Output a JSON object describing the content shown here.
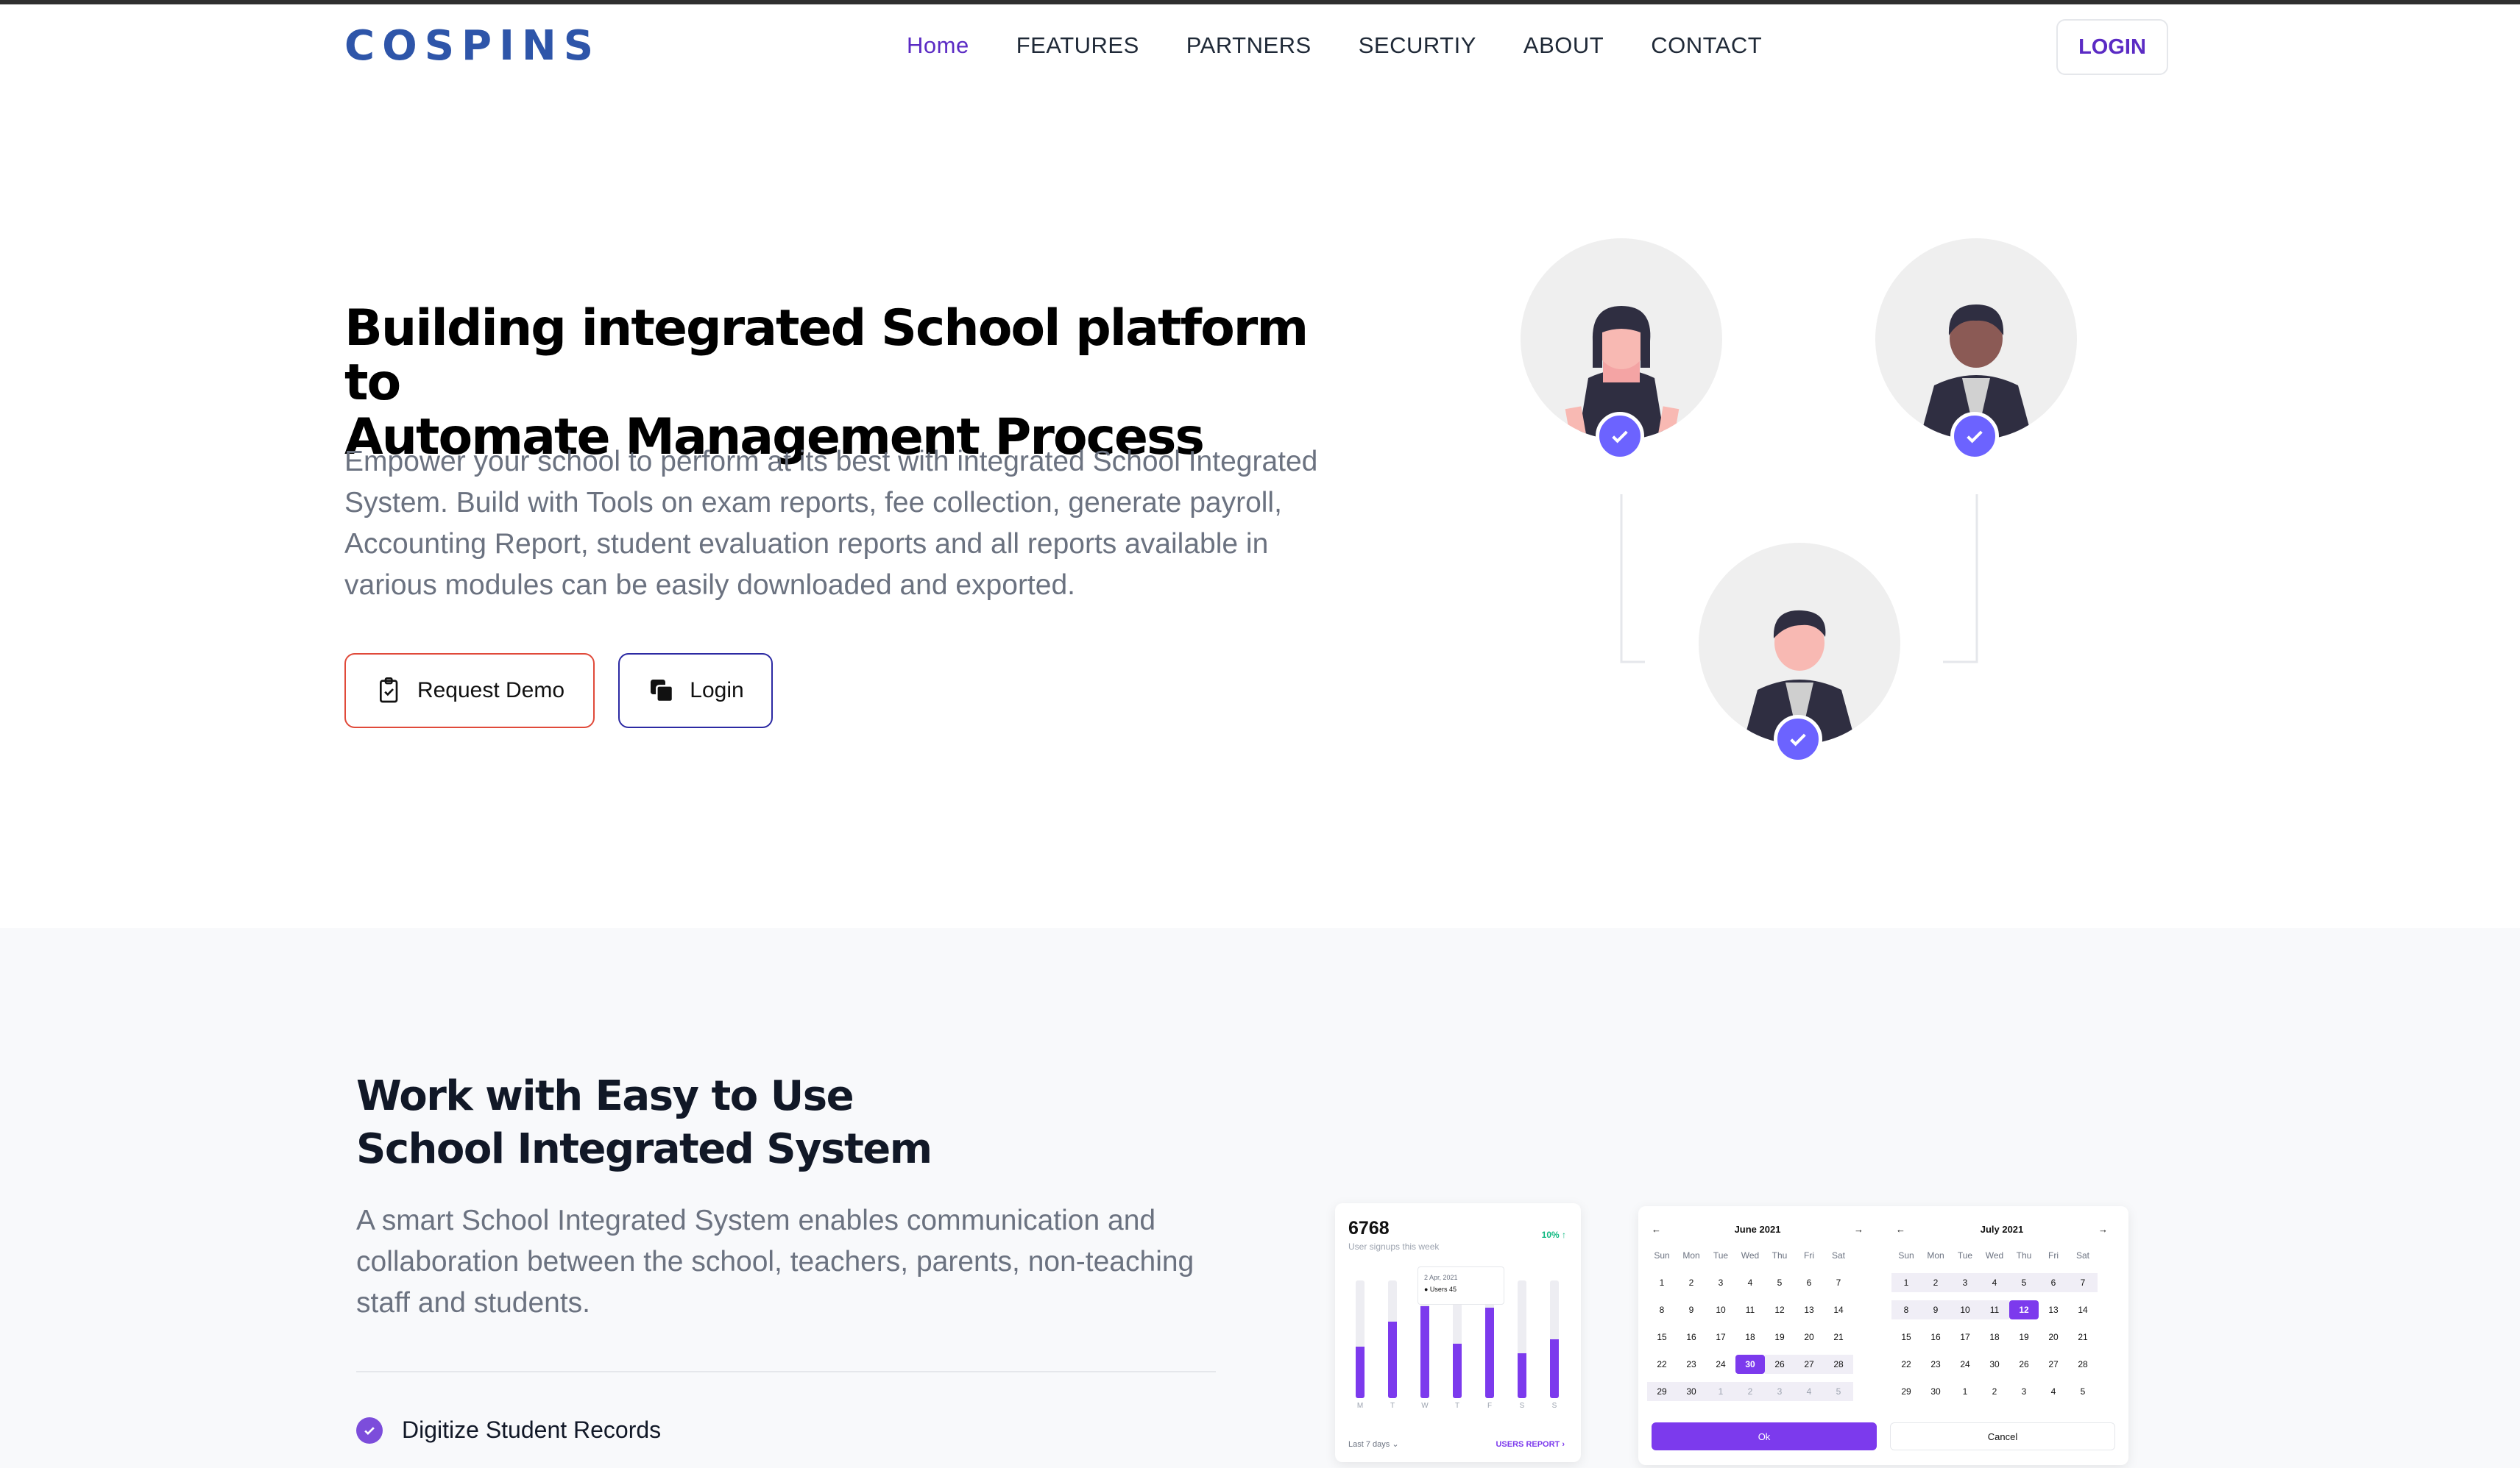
{
  "brand": {
    "logo": "COSPINS",
    "accent": "#5b2bc4",
    "logo_color": "#2e55a9"
  },
  "nav": {
    "items": [
      {
        "label": "Home",
        "active": true
      },
      {
        "label": "FEATURES"
      },
      {
        "label": "PARTNERS"
      },
      {
        "label": "SECURTIY"
      },
      {
        "label": "ABOUT"
      },
      {
        "label": "CONTACT"
      }
    ],
    "login_label": "LOGIN"
  },
  "hero": {
    "title_line1": "Building integrated School platform to",
    "title_line2": "Automate Management Process",
    "description": "Empower your school to perform at its best with integrated School Integrated System. Build with Tools on exam reports, fee collection, generate payroll, Accounting Report, student evaluation reports and all reports available in various modules can be easily downloaded and exported.",
    "request_demo_label": "Request Demo",
    "login_label": "Login"
  },
  "section2": {
    "title_line1": "Work with Easy to Use",
    "title_line2": "School Integrated System",
    "description": "A smart School Integrated System enables communication and collaboration between the school, teachers, parents, non-teaching staff and students.",
    "features": [
      "Digitize Student Records"
    ]
  },
  "stats_card": {
    "number": "6768",
    "subtitle": "User signups this week",
    "badge": "10% ↑",
    "tooltip_date": "2 Apr, 2021",
    "tooltip_value": "● Users 45",
    "days": [
      "M",
      "T",
      "W",
      "T",
      "F",
      "S",
      "S"
    ],
    "values": [
      0.44,
      0.65,
      0.78,
      0.46,
      0.77,
      0.38,
      0.5
    ],
    "footer": "Last 7 days ⌄",
    "link": "USERS REPORT ›"
  },
  "calendar": {
    "dow": [
      "Sun",
      "Mon",
      "Tue",
      "Wed",
      "Thu",
      "Fri",
      "Sat"
    ],
    "june": {
      "title": "June 2021",
      "days": [
        "1",
        "2",
        "3",
        "4",
        "5",
        "6",
        "7",
        "8",
        "9",
        "10",
        "11",
        "12",
        "13",
        "14",
        "15",
        "16",
        "17",
        "18",
        "19",
        "20",
        "21",
        "22",
        "23",
        "24",
        "30",
        "26",
        "27",
        "28",
        "29",
        "30",
        "1",
        "2",
        "3",
        "4",
        "5"
      ],
      "selected_index": 24,
      "range_from": 24,
      "muted_from": 30
    },
    "july": {
      "title": "July 2021",
      "days": [
        "1",
        "2",
        "3",
        "4",
        "5",
        "6",
        "7",
        "8",
        "9",
        "10",
        "11",
        "12",
        "13",
        "14",
        "15",
        "16",
        "17",
        "18",
        "19",
        "20",
        "21",
        "22",
        "23",
        "24",
        "30",
        "26",
        "27",
        "28",
        "29",
        "30",
        "1",
        "2",
        "3",
        "4",
        "5"
      ],
      "selected_index": 11,
      "range_to": 11
    },
    "ok_label": "Ok",
    "cancel_label": "Cancel"
  }
}
